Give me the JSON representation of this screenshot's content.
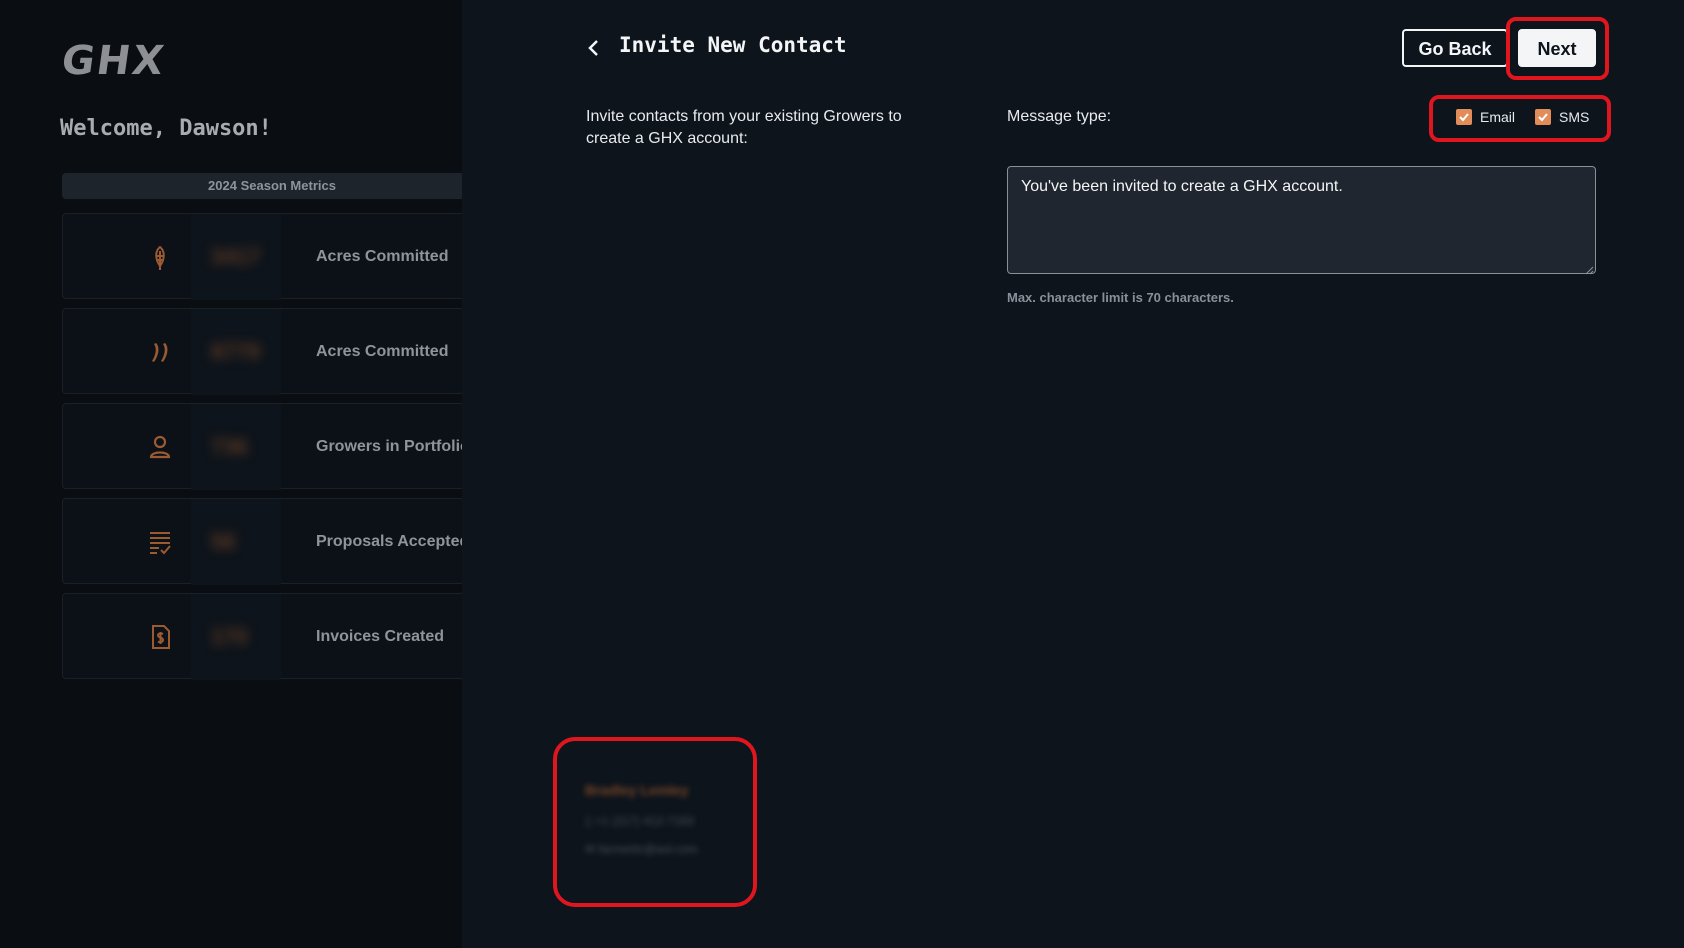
{
  "sidebar": {
    "logo": "GHX",
    "welcome": "Welcome, Dawson!",
    "metrics_header": "2024 Season Metrics",
    "metrics": [
      {
        "icon": "corn-icon",
        "value": "3417",
        "label": "Acres Committed"
      },
      {
        "icon": "wheat-icon",
        "value": "8779",
        "label": "Acres Committed"
      },
      {
        "icon": "person-icon",
        "value": "736",
        "label": "Growers in Portfolio"
      },
      {
        "icon": "checklist-icon",
        "value": "56",
        "label": "Proposals Accepted"
      },
      {
        "icon": "invoice-icon",
        "value": "170",
        "label": "Invoices Created"
      }
    ]
  },
  "header": {
    "title": "Invite New Contact",
    "go_back_label": "Go Back",
    "next_label": "Next"
  },
  "form": {
    "intro": "Invite contacts from your existing Growers to create a GHX account:",
    "message_type_label": "Message type:",
    "options": [
      {
        "label": "Email",
        "checked": true
      },
      {
        "label": "SMS",
        "checked": true
      }
    ],
    "message": "You've been invited to create a GHX account.",
    "char_limit_hint": "Max. character limit is 70 characters."
  },
  "contact": {
    "name": "Bradley Lemley",
    "phone": "+1 (217) 412-7183",
    "email": "farmerbr@aol.com"
  },
  "colors": {
    "accent": "#e28c59",
    "highlight": "#e0161f",
    "background": "#0d141c",
    "sidebar": "#0a0e13"
  }
}
